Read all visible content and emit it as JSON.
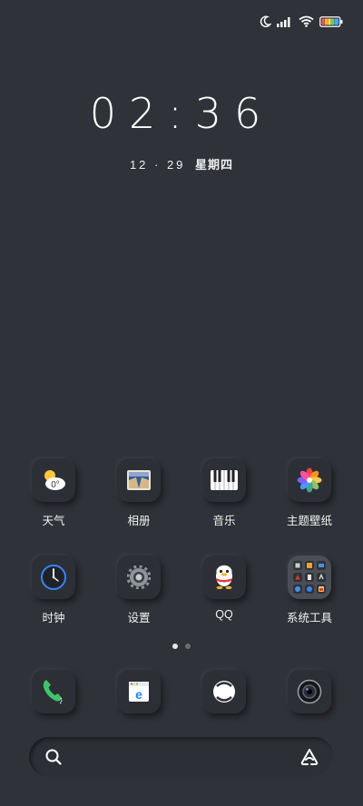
{
  "status_bar": {
    "icons": [
      "moon-icon",
      "signal-icon",
      "wifi-icon",
      "battery-icon"
    ]
  },
  "clock": {
    "time": "02:36",
    "date": "12 · 29",
    "weekday": "星期四"
  },
  "apps": [
    {
      "label": "天气",
      "icon": "weather-icon",
      "temp": "0°"
    },
    {
      "label": "相册",
      "icon": "gallery-icon"
    },
    {
      "label": "音乐",
      "icon": "piano-icon"
    },
    {
      "label": "主题壁纸",
      "icon": "theme-flower-icon"
    },
    {
      "label": "时钟",
      "icon": "clock-icon"
    },
    {
      "label": "设置",
      "icon": "gear-icon"
    },
    {
      "label": "QQ",
      "icon": "qq-penguin-icon"
    },
    {
      "label": "系统工具",
      "icon": "folder-icon"
    }
  ],
  "page_indicator": {
    "pages": 2,
    "current": 1
  },
  "dock": [
    {
      "name": "phone",
      "icon": "phone-icon"
    },
    {
      "name": "browser",
      "icon": "browser-icon"
    },
    {
      "name": "messages",
      "icon": "message-icon"
    },
    {
      "name": "camera",
      "icon": "camera-icon"
    }
  ],
  "search": {
    "icon": "search-icon",
    "assistant_icon": "jovi-icon"
  },
  "colors": {
    "background": "#2f3238",
    "tile": "#2c2f35",
    "accent_blue": "#3b82f6",
    "phone_green": "#3ec46d"
  }
}
